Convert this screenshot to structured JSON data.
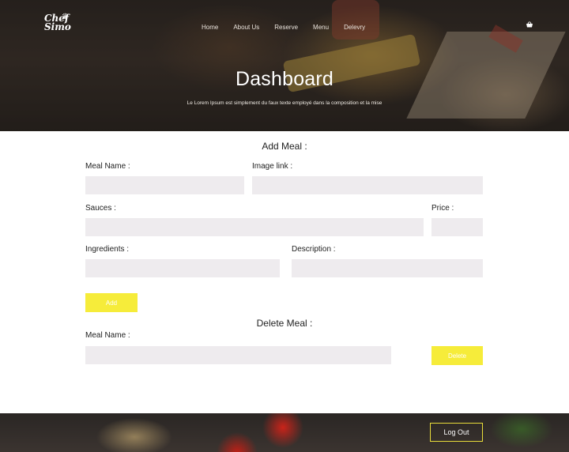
{
  "header": {
    "logo_text_line1": "Chef",
    "logo_text_line2": "Simo",
    "nav": [
      "Home",
      "About Us",
      "Reserve",
      "Menu",
      "Delevry"
    ],
    "cart_icon": "basket-icon",
    "title": "Dashboard",
    "subtitle": "Le Lorem Ipsum est simplement du faux texte employé dans la composition et la mise"
  },
  "add_meal": {
    "title": "Add Meal :",
    "meal_name_label": "Meal Name :",
    "image_link_label": "Image link :",
    "sauces_label": "Sauces :",
    "price_label": "Price :",
    "ingredients_label": "Ingredients :",
    "description_label": "Description :",
    "add_button": "Add",
    "meal_name_value": "",
    "image_link_value": "",
    "sauces_value": "",
    "price_value": "",
    "ingredients_value": "",
    "description_value": ""
  },
  "delete_meal": {
    "title": "Delete Meal :",
    "meal_name_label": "Meal Name :",
    "meal_name_value": "",
    "delete_button": "Delete"
  },
  "footer": {
    "logout_button": "Log Out"
  },
  "colors": {
    "accent": "#f6ec3a",
    "input_bg": "#eeebee"
  }
}
